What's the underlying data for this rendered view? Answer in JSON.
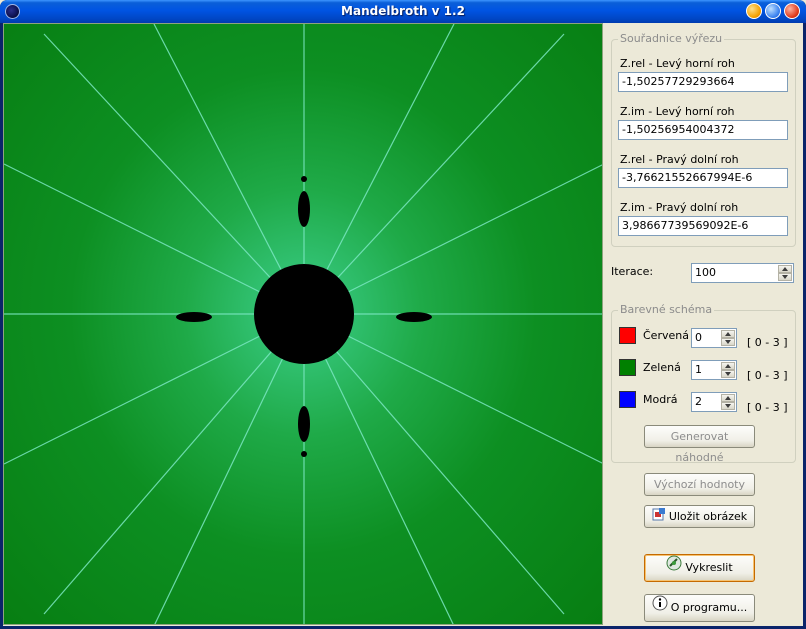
{
  "window": {
    "title": "Mandelbroth v 1.2"
  },
  "coords": {
    "caption": "Souřadnice výřezu",
    "fields": [
      {
        "label": "Z.rel - Levý horní roh",
        "value": "-1,50257729293664"
      },
      {
        "label": "Z.im - Levý horní roh",
        "value": "-1,50256954004372"
      },
      {
        "label": "Z.rel - Pravý dolní roh",
        "value": "-3,76621552667994E-6"
      },
      {
        "label": "Z.im - Pravý dolní roh",
        "value": "3,98667739569092E-6"
      }
    ]
  },
  "iterations": {
    "label": "Iterace:",
    "value": "100"
  },
  "scheme": {
    "caption": "Barevné schéma",
    "channels": [
      {
        "label": "Červená",
        "value": "0",
        "range": "[ 0 - 3 ]",
        "color": "#ff0000"
      },
      {
        "label": "Zelená",
        "value": "1",
        "range": "[ 0 - 3 ]",
        "color": "#008000"
      },
      {
        "label": "Modrá",
        "value": "2",
        "range": "[ 0 - 3 ]",
        "color": "#0000ff"
      }
    ],
    "random_button": "Generovat náhodné"
  },
  "buttons": {
    "defaults": "Výchozí hodnoty",
    "save": "Uložit obrázek",
    "draw": "Vykreslit",
    "about": "O programu..."
  }
}
